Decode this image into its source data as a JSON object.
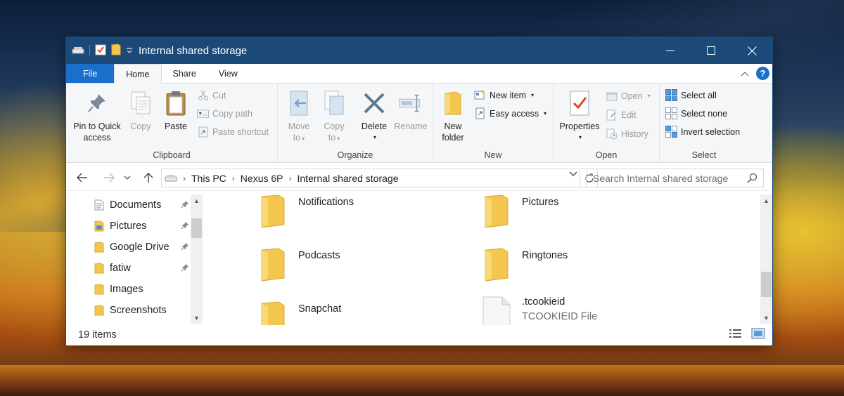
{
  "window": {
    "title": "Internal shared storage"
  },
  "tabs": {
    "file": "File",
    "home": "Home",
    "share": "Share",
    "view": "View"
  },
  "ribbon": {
    "clipboard": {
      "label": "Clipboard",
      "pin": "Pin to Quick access",
      "pin_line1": "Pin to Quick",
      "pin_line2": "access",
      "copy": "Copy",
      "paste": "Paste",
      "cut": "Cut",
      "copy_path": "Copy path",
      "paste_shortcut": "Paste shortcut"
    },
    "organize": {
      "label": "Organize",
      "move_to_1": "Move",
      "move_to_2": "to",
      "copy_to_1": "Copy",
      "copy_to_2": "to",
      "delete": "Delete",
      "rename": "Rename"
    },
    "new": {
      "label": "New",
      "new_folder_1": "New",
      "new_folder_2": "folder",
      "new_item": "New item",
      "easy_access": "Easy access"
    },
    "open": {
      "label": "Open",
      "properties": "Properties",
      "open": "Open",
      "edit": "Edit",
      "history": "History"
    },
    "select": {
      "label": "Select",
      "select_all": "Select all",
      "select_none": "Select none",
      "invert_selection": "Invert selection"
    }
  },
  "address": {
    "crumbs": [
      "This PC",
      "Nexus 6P",
      "Internal shared storage"
    ],
    "search_placeholder": "Search Internal shared storage"
  },
  "nav": {
    "items": [
      {
        "label": "Documents",
        "pinned": true
      },
      {
        "label": "Pictures",
        "pinned": true
      },
      {
        "label": "Google Drive",
        "pinned": true
      },
      {
        "label": "fatiw",
        "pinned": true
      },
      {
        "label": "Images",
        "pinned": false
      },
      {
        "label": "Screenshots",
        "pinned": false
      }
    ]
  },
  "files": [
    {
      "name": "Notifications",
      "type": "folder"
    },
    {
      "name": "Pictures",
      "type": "folder"
    },
    {
      "name": "Podcasts",
      "type": "folder"
    },
    {
      "name": "Ringtones",
      "type": "folder"
    },
    {
      "name": "Snapchat",
      "type": "folder"
    },
    {
      "name": ".tcookieid",
      "type": "file",
      "subtitle": "TCOOKIEID File"
    }
  ],
  "status": {
    "item_count": "19 items"
  },
  "colors": {
    "titlebar": "#1b4a78",
    "file_tab": "#1a6fcb",
    "folder": "#f3c74f"
  }
}
